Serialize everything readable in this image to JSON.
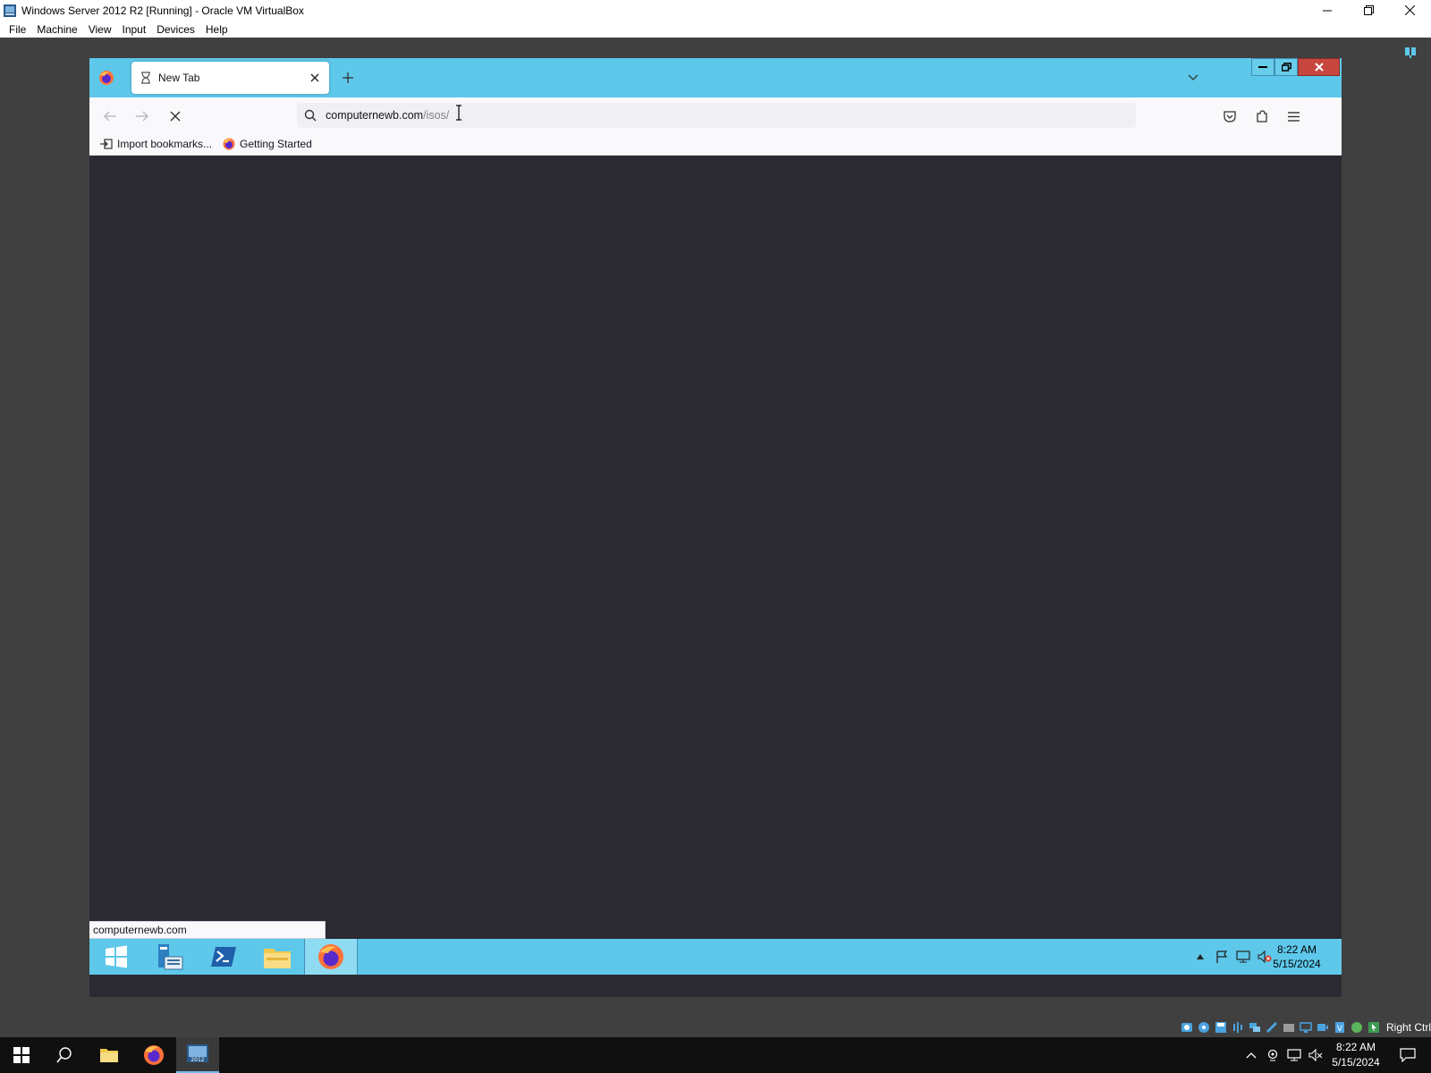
{
  "host_window": {
    "title": "Windows Server 2012 R2 [Running] - Oracle VM VirtualBox",
    "menu": [
      "File",
      "Machine",
      "View",
      "Input",
      "Devices",
      "Help"
    ]
  },
  "browser": {
    "tab_title": "New Tab",
    "url_host": "computernewb.com",
    "url_path": "/isos/",
    "bookmarks": [
      "Import bookmarks...",
      "Getting Started"
    ],
    "status_text": "computernewb.com"
  },
  "guest_taskbar": {
    "time": "8:22 AM",
    "date": "5/15/2024"
  },
  "vbox_status": {
    "host_key": "Right Ctrl"
  },
  "host_taskbar": {
    "time": "8:22 AM",
    "date": "5/15/2024"
  },
  "colors": {
    "guest_accent": "#5ec8ea",
    "browser_content_bg": "#2b2a33",
    "host_taskbar_bg": "#101010"
  }
}
